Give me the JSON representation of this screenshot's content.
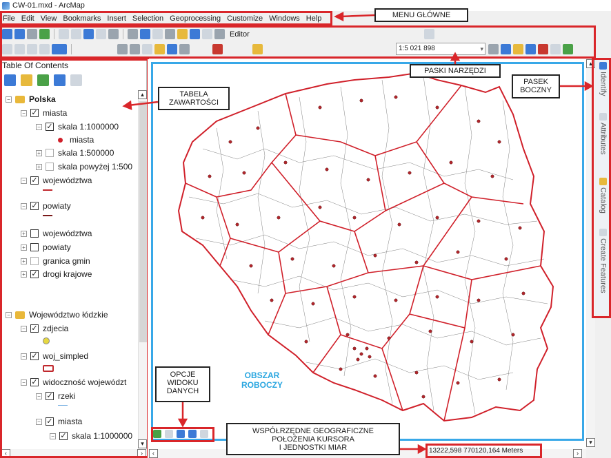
{
  "window": {
    "title": "CW-01.mxd - ArcMap"
  },
  "menu": {
    "items": [
      "File",
      "Edit",
      "View",
      "Bookmarks",
      "Insert",
      "Selection",
      "Geoprocessing",
      "Customize",
      "Windows",
      "Help"
    ]
  },
  "toolbar": {
    "editor_label": "Editor",
    "scale_value": "1:5 021 898"
  },
  "toc": {
    "title": "Table Of Contents",
    "groups": [
      {
        "label": "Polska"
      },
      {
        "label": "Województwo łódzkie"
      }
    ],
    "layers": [
      "miasta",
      "skala 1:1000000",
      "miasta",
      "skala 1:500000",
      "skala powyżej 1:500",
      "województwa",
      "powiaty",
      "województwa",
      "powiaty",
      "granica gmin",
      "drogi krajowe",
      "zdjecia",
      "woj_simpled",
      "widoczność województ",
      "rzeki",
      "miasta",
      "skala 1:1000000"
    ]
  },
  "sidebar": {
    "tabs": [
      "Identify",
      "Attributes",
      "Catalog",
      "Create Features"
    ]
  },
  "status": {
    "coords": "13222,598  770120,164 Meters"
  },
  "annotations": {
    "menu": "MENU GŁÓWNE",
    "toolbars": "PASKI NARZĘDZI",
    "sidebar_line1": "PASEK",
    "sidebar_line2": "BOCZNY",
    "toc_line1": "TABELA",
    "toc_line2": "ZAWARTOŚCI",
    "view_line1": "OPCJE",
    "view_line2": "WIDOKU",
    "view_line3": "DANYCH",
    "coords_line1": "WSPÓŁRZĘDNE GEOGRAFICZNE",
    "coords_line2": "POŁOŻENIA KURSORA",
    "coords_line3": "I JEDNOSTKI MIAR",
    "work_line1": "OBSZAR",
    "work_line2": "ROBOCZY"
  },
  "colors": {
    "annotation_red": "#d9262a",
    "map_frame_blue": "#38a8e8",
    "region_red": "#d0202a",
    "city_dot": "#b3262c"
  }
}
